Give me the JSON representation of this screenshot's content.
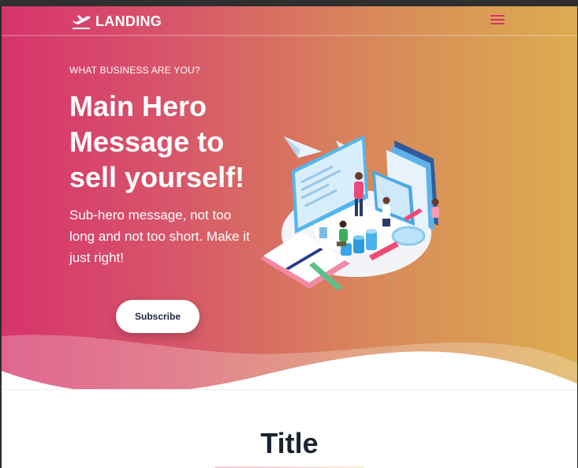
{
  "nav": {
    "brand_label": "LANDING",
    "brand_icon": "plane-takeoff-icon",
    "menu_icon": "hamburger-menu-icon"
  },
  "hero": {
    "eyebrow": "WHAT BUSINESS ARE YOU?",
    "headline": "Main Hero Message to sell yourself!",
    "subtext": "Sub-hero message, not too long and not too short. Make it just right!",
    "cta_label": "Subscribe",
    "illustration": "isometric-workspace-illustration"
  },
  "section": {
    "title": "Title"
  },
  "colors": {
    "gradient_start": "#d6336c",
    "gradient_end": "#dcac4f",
    "menu_accent": "#d6336c",
    "title_text": "#1a2330",
    "button_text": "#1f2540"
  }
}
